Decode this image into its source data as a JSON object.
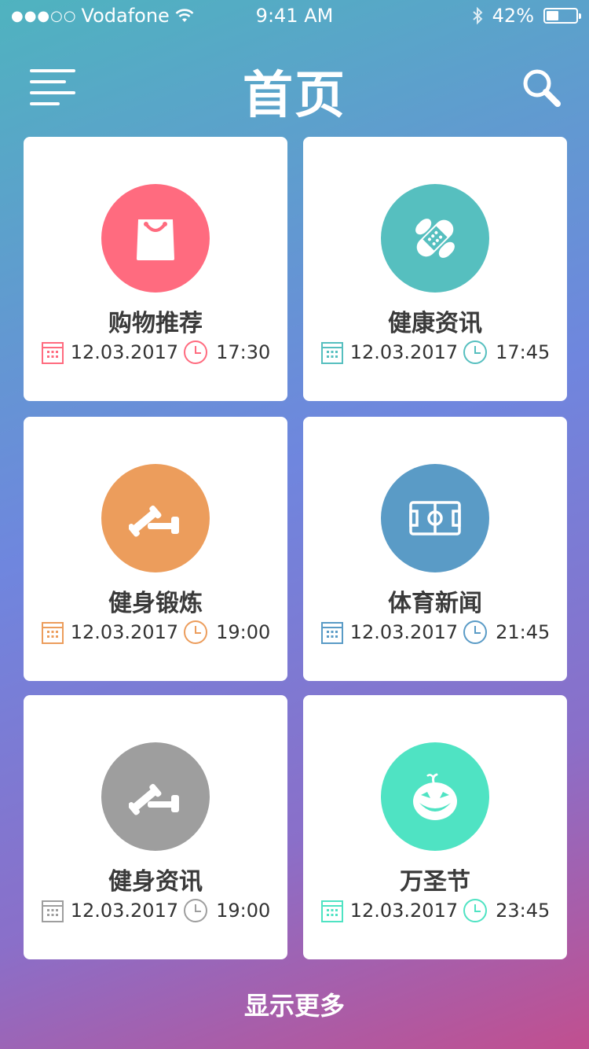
{
  "status": {
    "carrier": "Vodafone",
    "signal_dots": "●●●○○",
    "time": "9:41 AM",
    "battery": "42%",
    "battery_level": 0.42
  },
  "header": {
    "title": "首页",
    "menu_icon": "menu-icon",
    "search_icon": "search-icon"
  },
  "cards": [
    {
      "title": "购物推荐",
      "date": "12.03.2017",
      "time": "17:30",
      "color": "#ff6b7f",
      "icon": "shopping-bag-icon"
    },
    {
      "title": "健康资讯",
      "date": "12.03.2017",
      "time": "17:45",
      "color": "#56bfbf",
      "icon": "bandage-icon"
    },
    {
      "title": "健身锻炼",
      "date": "12.03.2017",
      "time": "19:00",
      "color": "#ec9d5c",
      "icon": "dumbbell-icon"
    },
    {
      "title": "体育新闻",
      "date": "12.03.2017",
      "time": "21:45",
      "color": "#5a9bc6",
      "icon": "soccer-field-icon"
    },
    {
      "title": "健身资讯",
      "date": "12.03.2017",
      "time": "19:00",
      "color": "#9e9e9e",
      "icon": "dumbbell-icon"
    },
    {
      "title": "万圣节",
      "date": "12.03.2017",
      "time": "23:45",
      "color": "#4fe3c3",
      "icon": "pumpkin-icon"
    }
  ],
  "footer": {
    "more_label": "显示更多"
  }
}
